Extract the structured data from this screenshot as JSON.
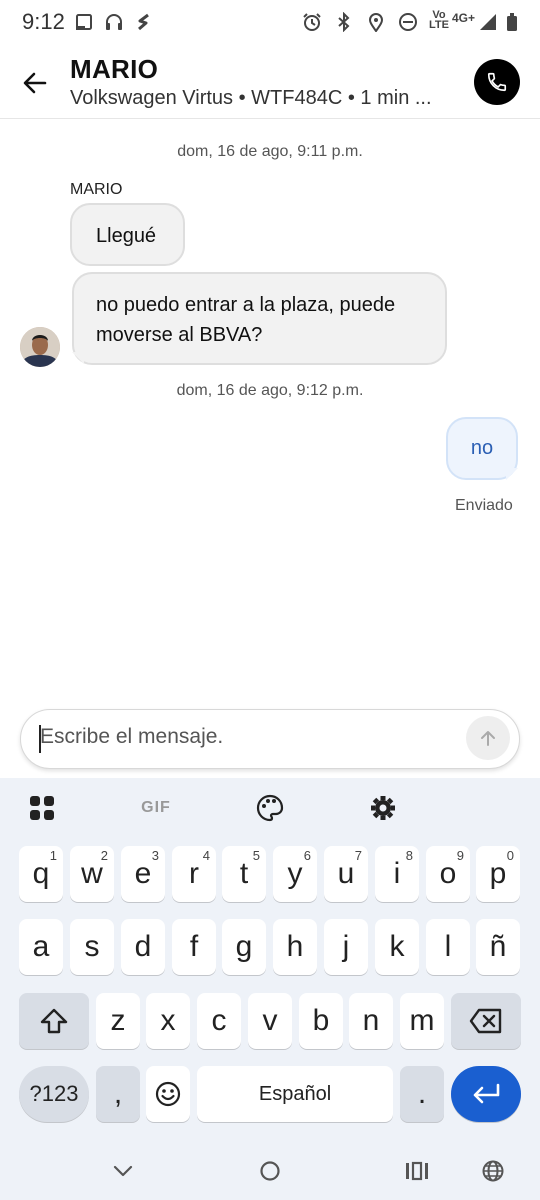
{
  "status_bar": {
    "time": "9:12",
    "network": "4G+",
    "volte": "Vo LTE"
  },
  "header": {
    "name": "MARIO",
    "subtitle": "Volkswagen Virtus • WTF484C • 1 min ..."
  },
  "chat": {
    "date_1": "dom, 16 de ago, 9:11 p.m.",
    "sender": "MARIO",
    "msg_1": "Llegué",
    "msg_2_line1": "no puedo entrar a la plaza, puede",
    "msg_2_line2": "moverse al BBVA?",
    "date_2": "dom, 16 de ago, 9:12 p.m.",
    "msg_out": "no",
    "sent_status": "Enviado"
  },
  "input": {
    "placeholder": "Escribe el mensaje."
  },
  "keyboard": {
    "gif": "GIF",
    "row1": [
      "q",
      "w",
      "e",
      "r",
      "t",
      "y",
      "u",
      "i",
      "o",
      "p"
    ],
    "row1_hints": [
      "1",
      "2",
      "3",
      "4",
      "5",
      "6",
      "7",
      "8",
      "9",
      "0"
    ],
    "row2": [
      "a",
      "s",
      "d",
      "f",
      "g",
      "h",
      "j",
      "k",
      "l",
      "ñ"
    ],
    "row3": [
      "z",
      "x",
      "c",
      "v",
      "b",
      "n",
      "m"
    ],
    "symbols": "?123",
    "comma": ",",
    "space": "Español",
    "period": "."
  },
  "colors": {
    "accent_blue": "#1a5fd0",
    "outgoing_text": "#2b5fb4",
    "call_button": "#000000"
  }
}
